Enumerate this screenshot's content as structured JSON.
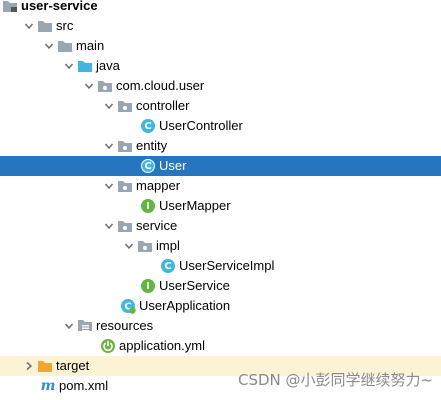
{
  "tree": {
    "root": {
      "label": "user-service",
      "icon": "module-folder-icon"
    },
    "src": {
      "label": "src"
    },
    "main": {
      "label": "main"
    },
    "java": {
      "label": "java"
    },
    "package": {
      "label": "com.cloud.user"
    },
    "controller": {
      "label": "controller"
    },
    "user_controller": {
      "label": "UserController"
    },
    "entity": {
      "label": "entity"
    },
    "user": {
      "label": "User"
    },
    "mapper": {
      "label": "mapper"
    },
    "user_mapper": {
      "label": "UserMapper"
    },
    "service": {
      "label": "service"
    },
    "impl": {
      "label": "impl"
    },
    "user_service_impl": {
      "label": "UserServiceImpl"
    },
    "user_service": {
      "label": "UserService"
    },
    "user_application": {
      "label": "UserApplication"
    },
    "resources": {
      "label": "resources"
    },
    "application_yml": {
      "label": "application.yml"
    },
    "target": {
      "label": "target"
    },
    "pom": {
      "label": "pom.xml"
    }
  },
  "watermark": "CSDN @小彭同学继续努力~",
  "colors": {
    "selection": "#2675BF",
    "excluded_folder_bg": "#FCF3D4",
    "folder": "#9AA7B0",
    "source_folder": "#40B6E0",
    "target_folder": "#F0A732",
    "class_icon": "#40B6E0",
    "interface_icon": "#62B543"
  }
}
